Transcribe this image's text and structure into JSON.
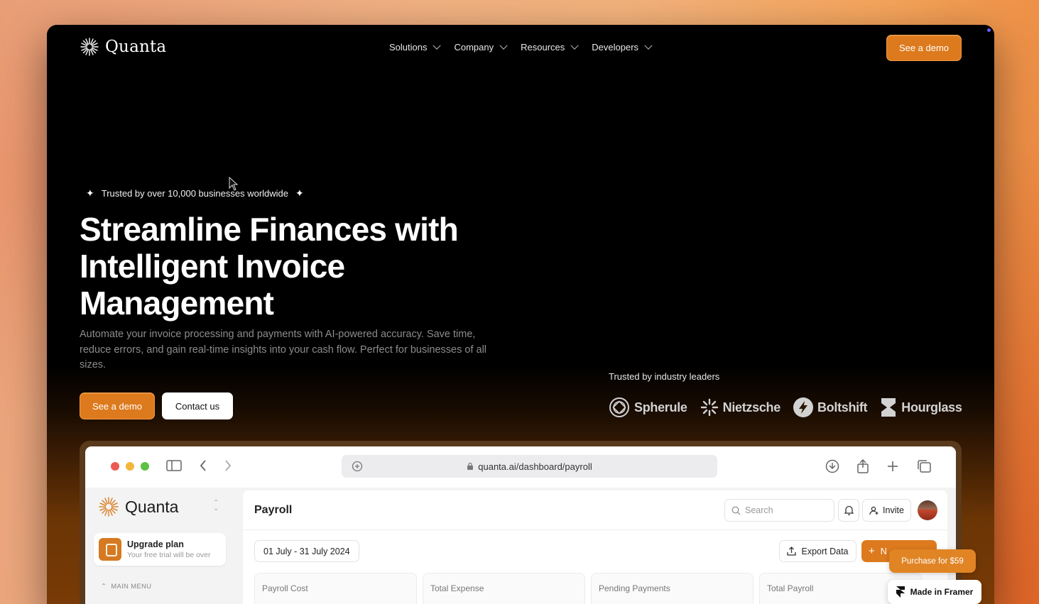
{
  "nav": {
    "brand": "Quanta",
    "items": [
      {
        "label": "Solutions"
      },
      {
        "label": "Company"
      },
      {
        "label": "Resources"
      },
      {
        "label": "Developers"
      }
    ],
    "cta": "See a demo"
  },
  "hero": {
    "trusted_text": "Trusted by over 10,000 businesses worldwide",
    "headline": "Streamline Finances with Intelligent Invoice Management",
    "subtext": "Automate your invoice processing and payments with AI-powered accuracy. Save time, reduce errors, and gain real-time insights into your cash flow. Perfect for businesses of all sizes.",
    "primary_cta": "See a demo",
    "secondary_cta": "Contact us"
  },
  "leaders": {
    "label": "Trusted by industry leaders",
    "logos": [
      "Spherule",
      "Nietzsche",
      "Boltshift",
      "Hourglass"
    ]
  },
  "mock": {
    "url": "quanta.ai/dashboard/payroll",
    "brand": "Quanta",
    "upgrade_title": "Upgrade plan",
    "upgrade_sub": "Your free trial will be over",
    "main_menu_label": "MAIN MENU",
    "page_title": "Payroll",
    "search_placeholder": "Search",
    "invite_label": "Invite",
    "date_range": "01 July - 31 July 2024",
    "export_label": "Export Data",
    "new_label": "N",
    "cards": [
      "Payroll Cost",
      "Total Expense",
      "Pending Payments",
      "Total Payroll"
    ]
  },
  "badges": {
    "purchase": "Purchase for $59",
    "framer": "Made in Framer"
  },
  "colors": {
    "accent": "#dd7a1d",
    "background": "#000000"
  }
}
